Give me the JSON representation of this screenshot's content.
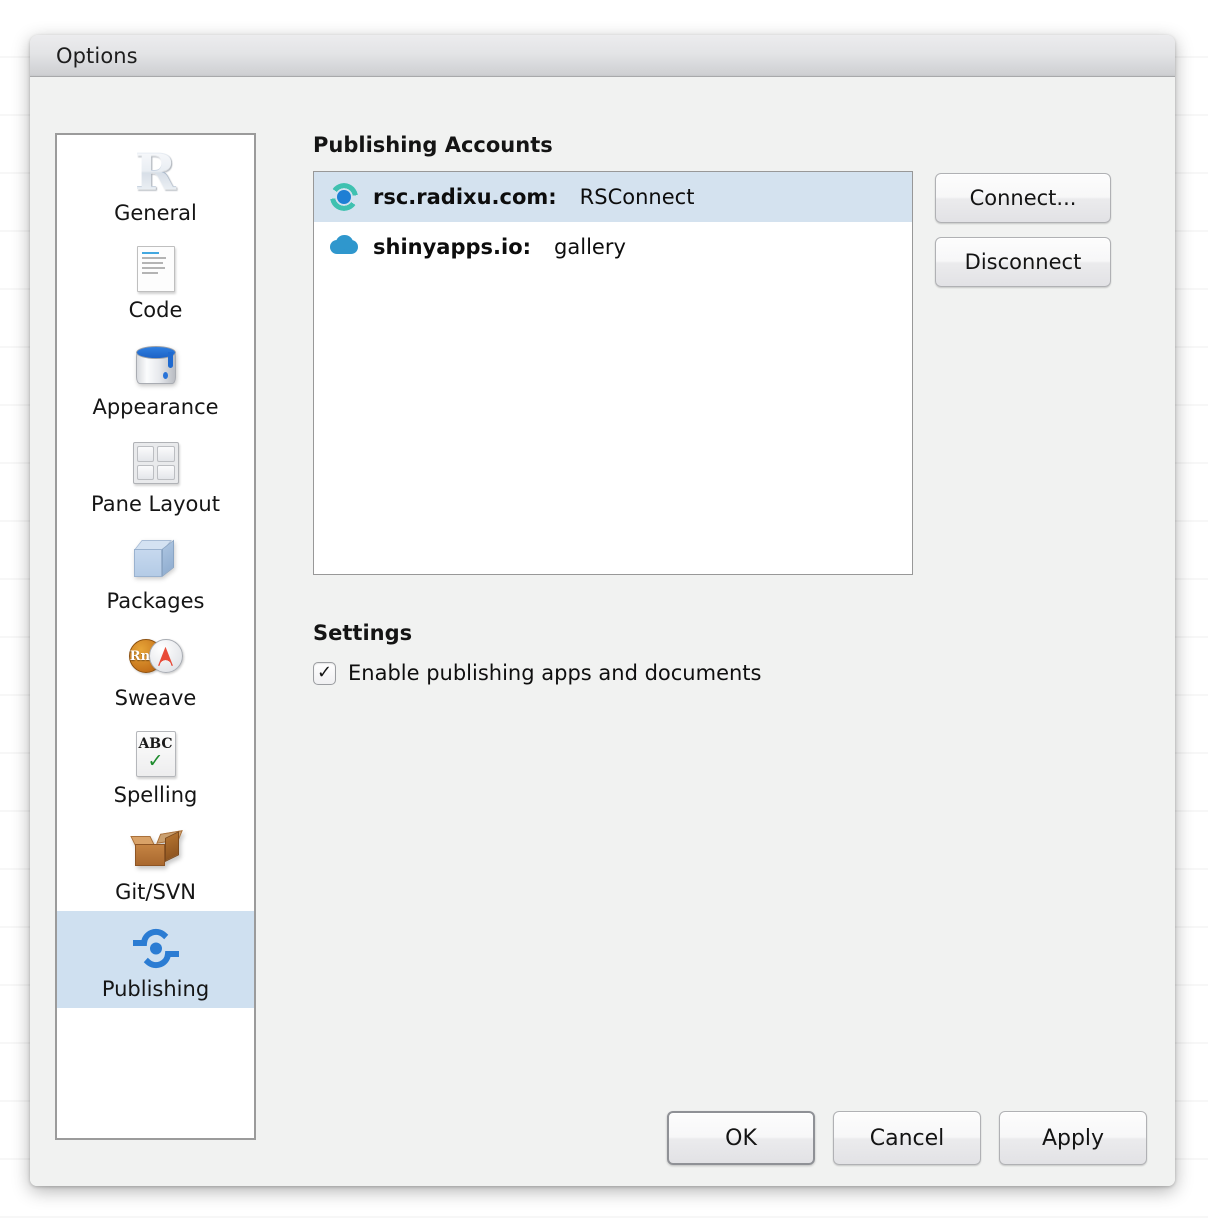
{
  "window": {
    "title": "Options"
  },
  "sidebar": {
    "items": [
      {
        "label": "General",
        "icon": "r-logo-icon",
        "selected": false
      },
      {
        "label": "Code",
        "icon": "document-icon",
        "selected": false
      },
      {
        "label": "Appearance",
        "icon": "paint-can-icon",
        "selected": false
      },
      {
        "label": "Pane Layout",
        "icon": "pane-grid-icon",
        "selected": false
      },
      {
        "label": "Packages",
        "icon": "package-box-icon",
        "selected": false
      },
      {
        "label": "Sweave",
        "icon": "rnw-pdf-icon",
        "selected": false
      },
      {
        "label": "Spelling",
        "icon": "abc-check-icon",
        "selected": false
      },
      {
        "label": "Git/SVN",
        "icon": "open-box-icon",
        "selected": false
      },
      {
        "label": "Publishing",
        "icon": "rsconnect-icon",
        "selected": true
      }
    ]
  },
  "main": {
    "accounts_heading": "Publishing Accounts",
    "accounts": [
      {
        "icon": "rsconnect-target-icon",
        "host": "rsc.radixu.com:",
        "name": "RSConnect",
        "selected": true
      },
      {
        "icon": "shinyapps-cloud-icon",
        "host": "shinyapps.io:",
        "name": "gallery",
        "selected": false
      }
    ],
    "connect_label": "Connect...",
    "disconnect_label": "Disconnect",
    "settings_heading": "Settings",
    "enable_publishing": {
      "label": "Enable publishing apps and documents",
      "checked": true,
      "check_glyph": "✓"
    }
  },
  "footer": {
    "ok_label": "OK",
    "cancel_label": "Cancel",
    "apply_label": "Apply"
  },
  "colors": {
    "selection_blue": "#cfe0f0",
    "list_selection_blue": "#d4e2ef",
    "dialog_bg": "#f1f2f1",
    "rsconnect_blue": "#2b7cd3",
    "cloud_blue": "#2f97cd"
  }
}
